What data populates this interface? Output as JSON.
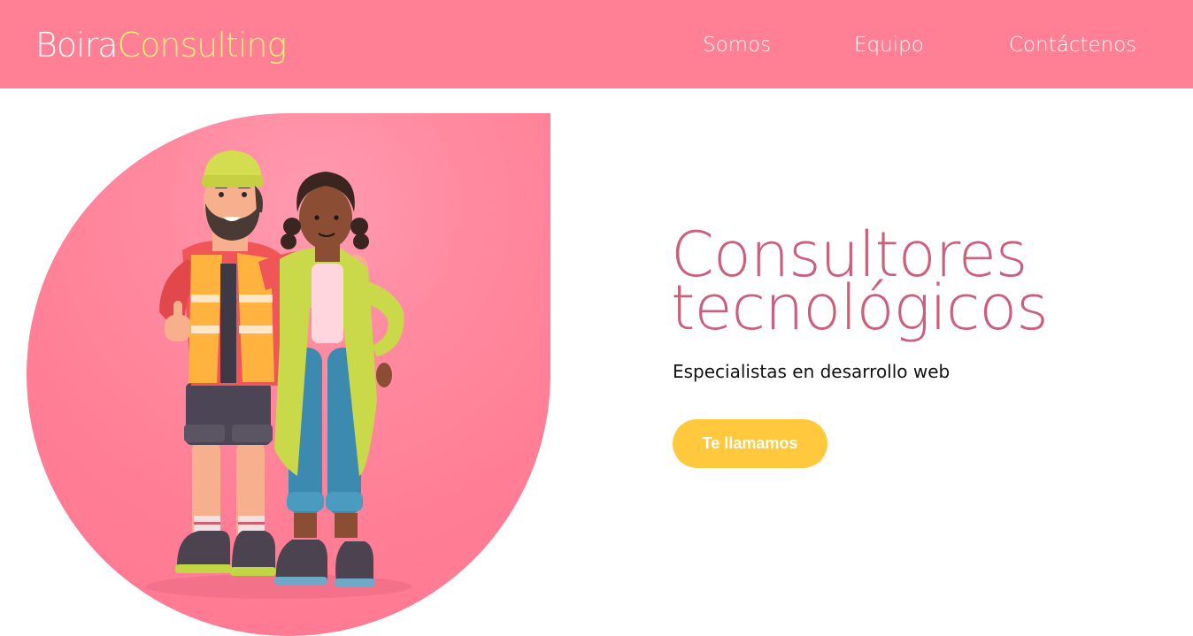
{
  "header": {
    "logo_part1": "Boira",
    "logo_part2": "Consulting",
    "nav": [
      "Somos",
      "Equipo",
      "Contáctenos"
    ]
  },
  "hero": {
    "title_line1": "Consultores",
    "title_line2": "tecnológicos",
    "subtitle": "Especialistas en desarrollo web",
    "cta_label": "Te llamamos"
  },
  "colors": {
    "header_bg": "#ff7f94",
    "logo_accent": "#fff07a",
    "title": "#cc5f7b",
    "cta_bg": "#ffc83d"
  }
}
